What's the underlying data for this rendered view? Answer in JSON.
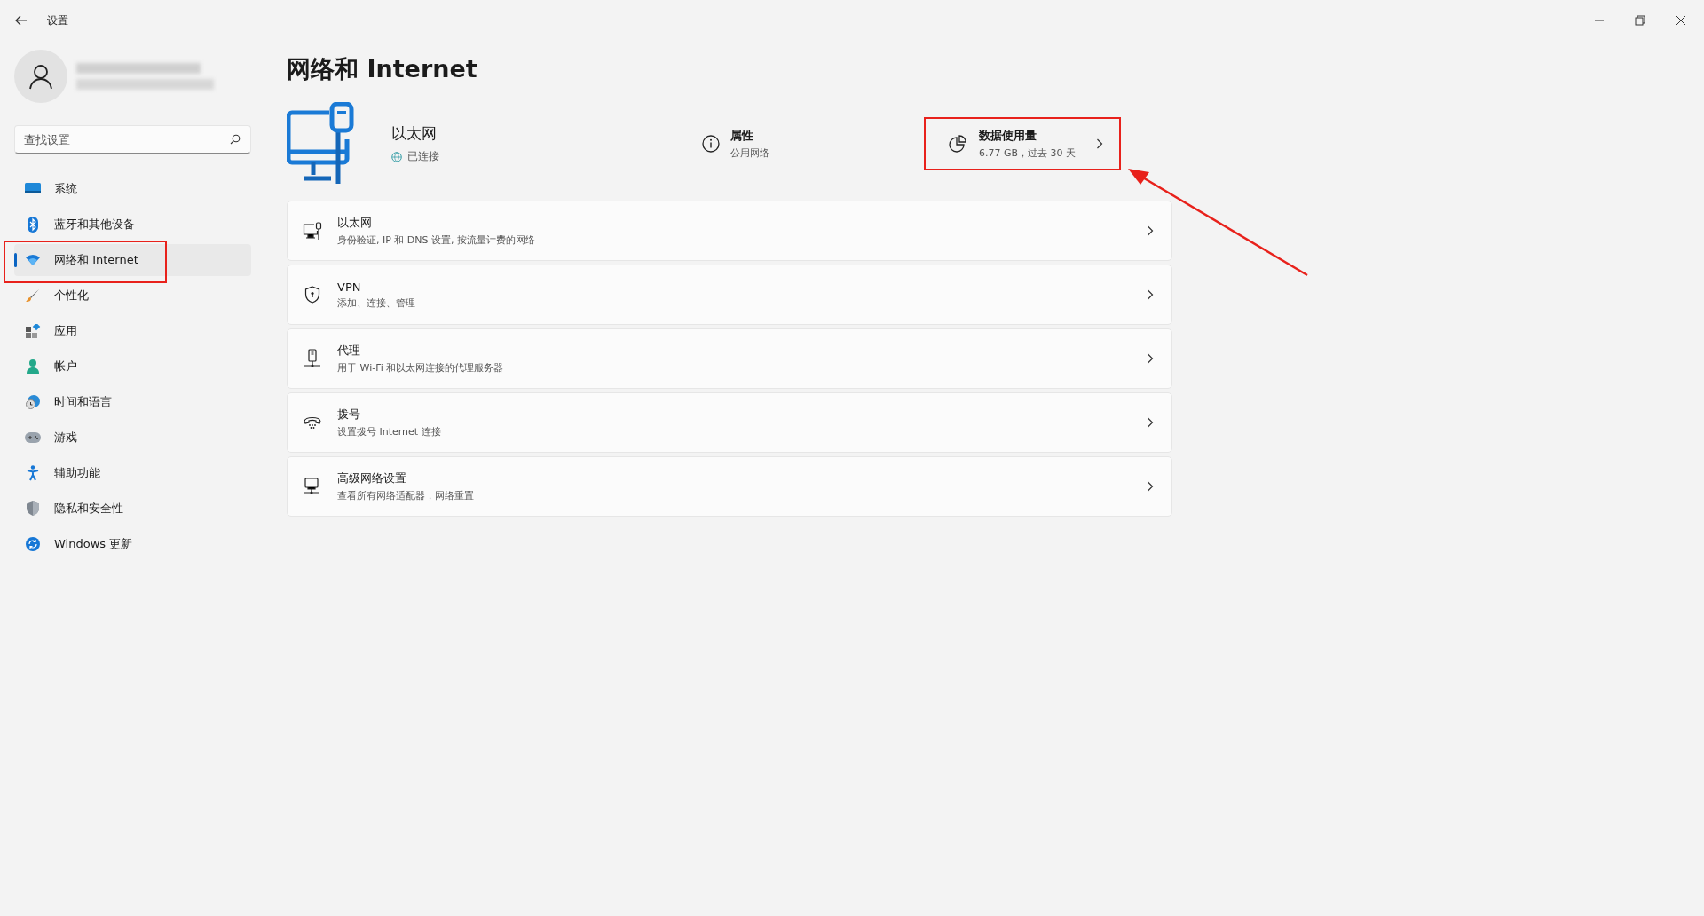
{
  "window": {
    "title": "设置"
  },
  "search": {
    "placeholder": "查找设置"
  },
  "sidebar": {
    "items": [
      {
        "label": "系统",
        "selected": false
      },
      {
        "label": "蓝牙和其他设备",
        "selected": false
      },
      {
        "label": "网络和 Internet",
        "selected": true
      },
      {
        "label": "个性化",
        "selected": false
      },
      {
        "label": "应用",
        "selected": false
      },
      {
        "label": "帐户",
        "selected": false
      },
      {
        "label": "时间和语言",
        "selected": false
      },
      {
        "label": "游戏",
        "selected": false
      },
      {
        "label": "辅助功能",
        "selected": false
      },
      {
        "label": "隐私和安全性",
        "selected": false
      },
      {
        "label": "Windows 更新",
        "selected": false
      }
    ]
  },
  "page_title": "网络和 Internet",
  "connection": {
    "name": "以太网",
    "status": "已连接"
  },
  "properties": {
    "title": "属性",
    "value": "公用网络"
  },
  "data_usage": {
    "title": "数据使用量",
    "value": "6.77 GB，过去 30 天"
  },
  "settings": [
    {
      "title": "以太网",
      "subtitle": "身份验证, IP 和 DNS 设置, 按流量计费的网络"
    },
    {
      "title": "VPN",
      "subtitle": "添加、连接、管理"
    },
    {
      "title": "代理",
      "subtitle": "用于 Wi-Fi 和以太网连接的代理服务器"
    },
    {
      "title": "拨号",
      "subtitle": "设置拨号 Internet 连接"
    },
    {
      "title": "高级网络设置",
      "subtitle": "查看所有网络适配器，网络重置"
    }
  ]
}
